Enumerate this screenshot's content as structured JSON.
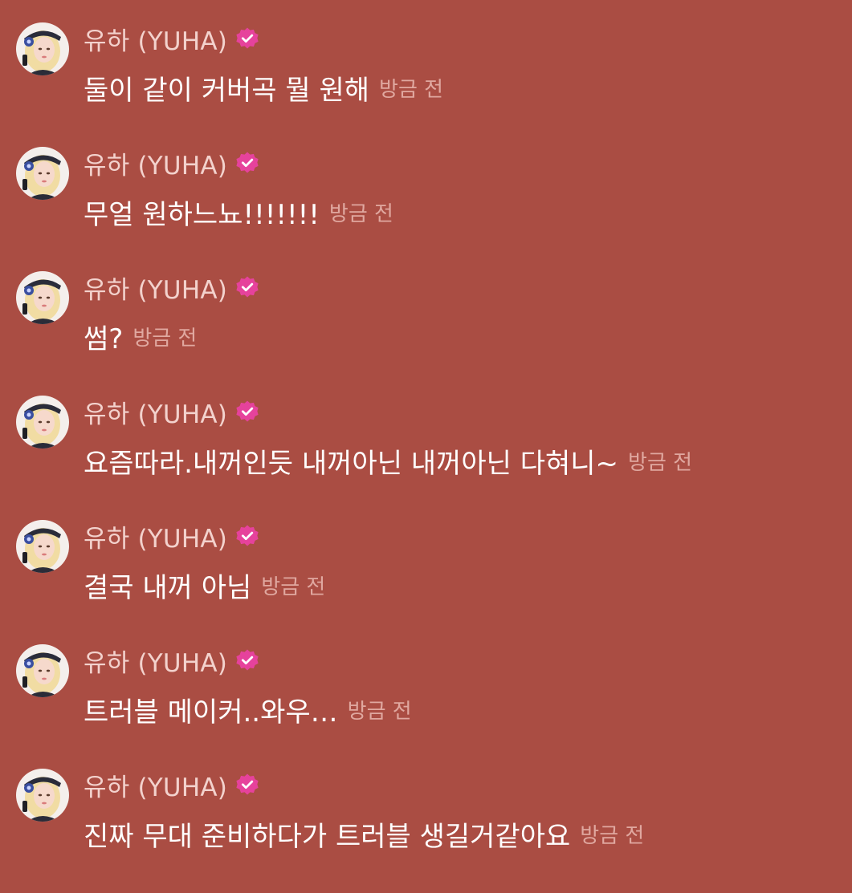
{
  "theme": {
    "background": "#aa4d43",
    "name_color": "#f3d2cd",
    "text_color": "#ffffff",
    "time_color": "#e0a8a0",
    "badge_color": "#e6429c"
  },
  "icons": {
    "avatar": "profile-photo",
    "badge": "verified-badge-icon"
  },
  "messages": [
    {
      "author": "유하 (YUHA)",
      "text": "둘이 같이 커버곡 뭘 원해",
      "time": "방금 전"
    },
    {
      "author": "유하 (YUHA)",
      "text": "무얼 원하느뇨!!!!!!!",
      "time": "방금 전"
    },
    {
      "author": "유하 (YUHA)",
      "text": "썸?",
      "time": "방금 전"
    },
    {
      "author": "유하 (YUHA)",
      "text": "요즘따라.내꺼인듯 내꺼아닌 내꺼아닌 다혀니~",
      "time": "방금 전"
    },
    {
      "author": "유하 (YUHA)",
      "text": "결국 내꺼 아님",
      "time": "방금 전"
    },
    {
      "author": "유하 (YUHA)",
      "text": "트러블 메이커..와우…",
      "time": "방금 전"
    },
    {
      "author": "유하 (YUHA)",
      "text": "진짜 무대 준비하다가 트러블 생길거같아요",
      "time": "방금 전"
    }
  ]
}
